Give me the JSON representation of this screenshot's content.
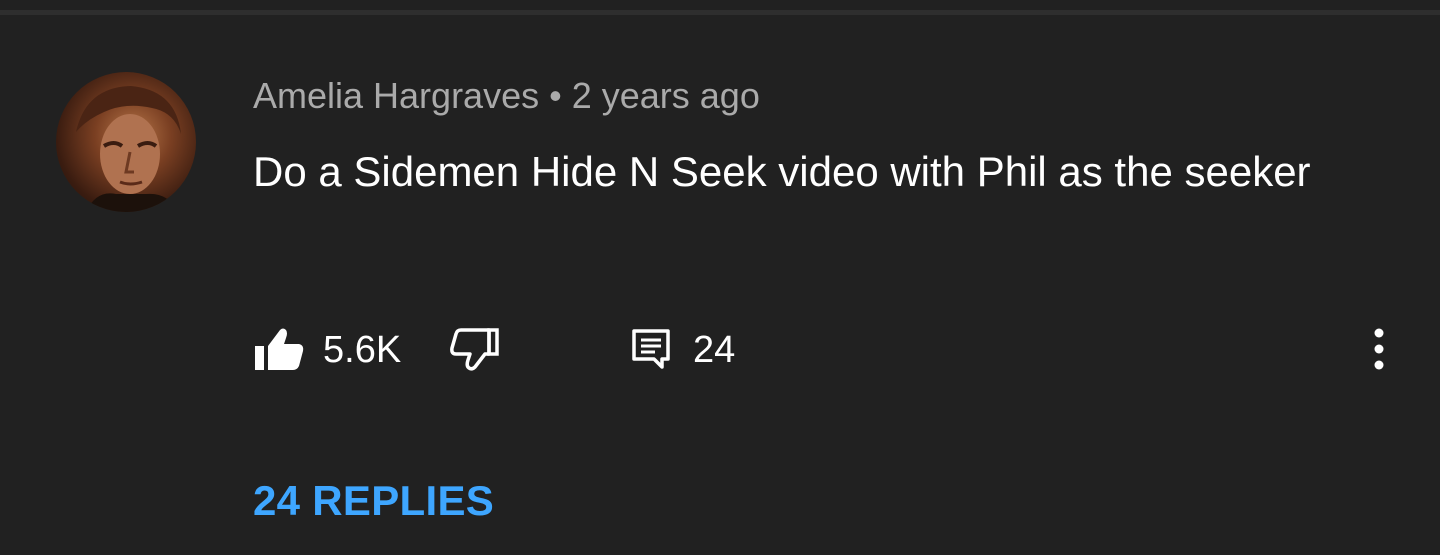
{
  "comment": {
    "author": "Amelia Hargraves",
    "separator": "•",
    "timestamp": "2 years ago",
    "text": "Do a Sidemen Hide N Seek video with Phil as the seeker",
    "likes": "5.6K",
    "reply_count": "24",
    "replies_link": "24 REPLIES",
    "avatar_icon": "avatar-photo",
    "like_icon": "thumbs-up-filled-icon",
    "dislike_icon": "thumbs-down-outline-icon",
    "reply_icon": "comment-icon",
    "more_icon": "more-vertical-icon"
  },
  "colors": {
    "background": "#212121",
    "primary_text": "#ffffff",
    "secondary_text": "#aaaaaa",
    "link": "#3ea6ff"
  }
}
